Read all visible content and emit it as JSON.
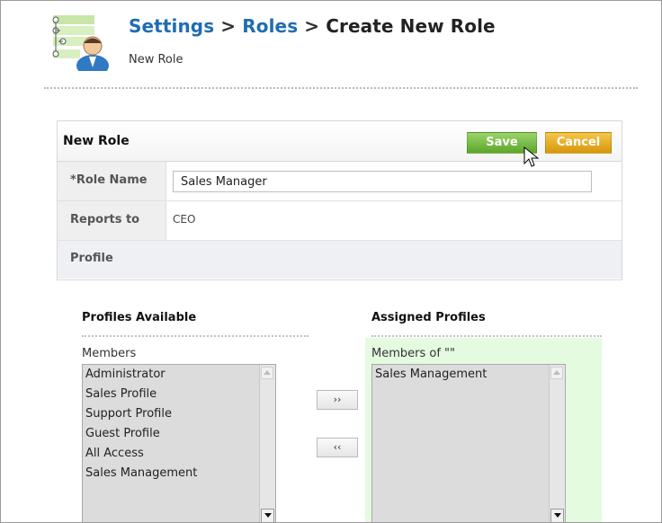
{
  "header": {
    "crumbs": [
      "Settings",
      "Roles",
      "Create New Role"
    ],
    "separator": ">",
    "subtitle": "New Role"
  },
  "panel": {
    "title": "New Role",
    "save_label": "Save",
    "cancel_label": "Cancel"
  },
  "form": {
    "role_name": {
      "required_mark": "*",
      "label": "Role Name",
      "value": "Sales Manager"
    },
    "reports_to": {
      "label": "Reports to",
      "value": "CEO"
    },
    "profile": {
      "label": "Profile"
    }
  },
  "profiles_available": {
    "title": "Profiles Available",
    "members_label": "Members",
    "items": [
      "Administrator",
      "Sales Profile",
      "Support Profile",
      "Guest Profile",
      "All Access",
      "Sales Management"
    ]
  },
  "assigned_profiles": {
    "title": "Assigned Profiles",
    "members_label": "Members of \"\"",
    "items": [
      "Sales Management"
    ]
  },
  "move_buttons": {
    "add": "››",
    "remove": "‹‹"
  },
  "colors": {
    "link": "#1f6db3",
    "save": "#6fb83a",
    "cancel": "#e0a21a",
    "assigned_bg": "#e4fbe0",
    "required": "#d0262a"
  },
  "icons": [
    "role-hierarchy-icon",
    "pointer-cursor-icon",
    "scroll-up-icon",
    "scroll-down-icon"
  ]
}
